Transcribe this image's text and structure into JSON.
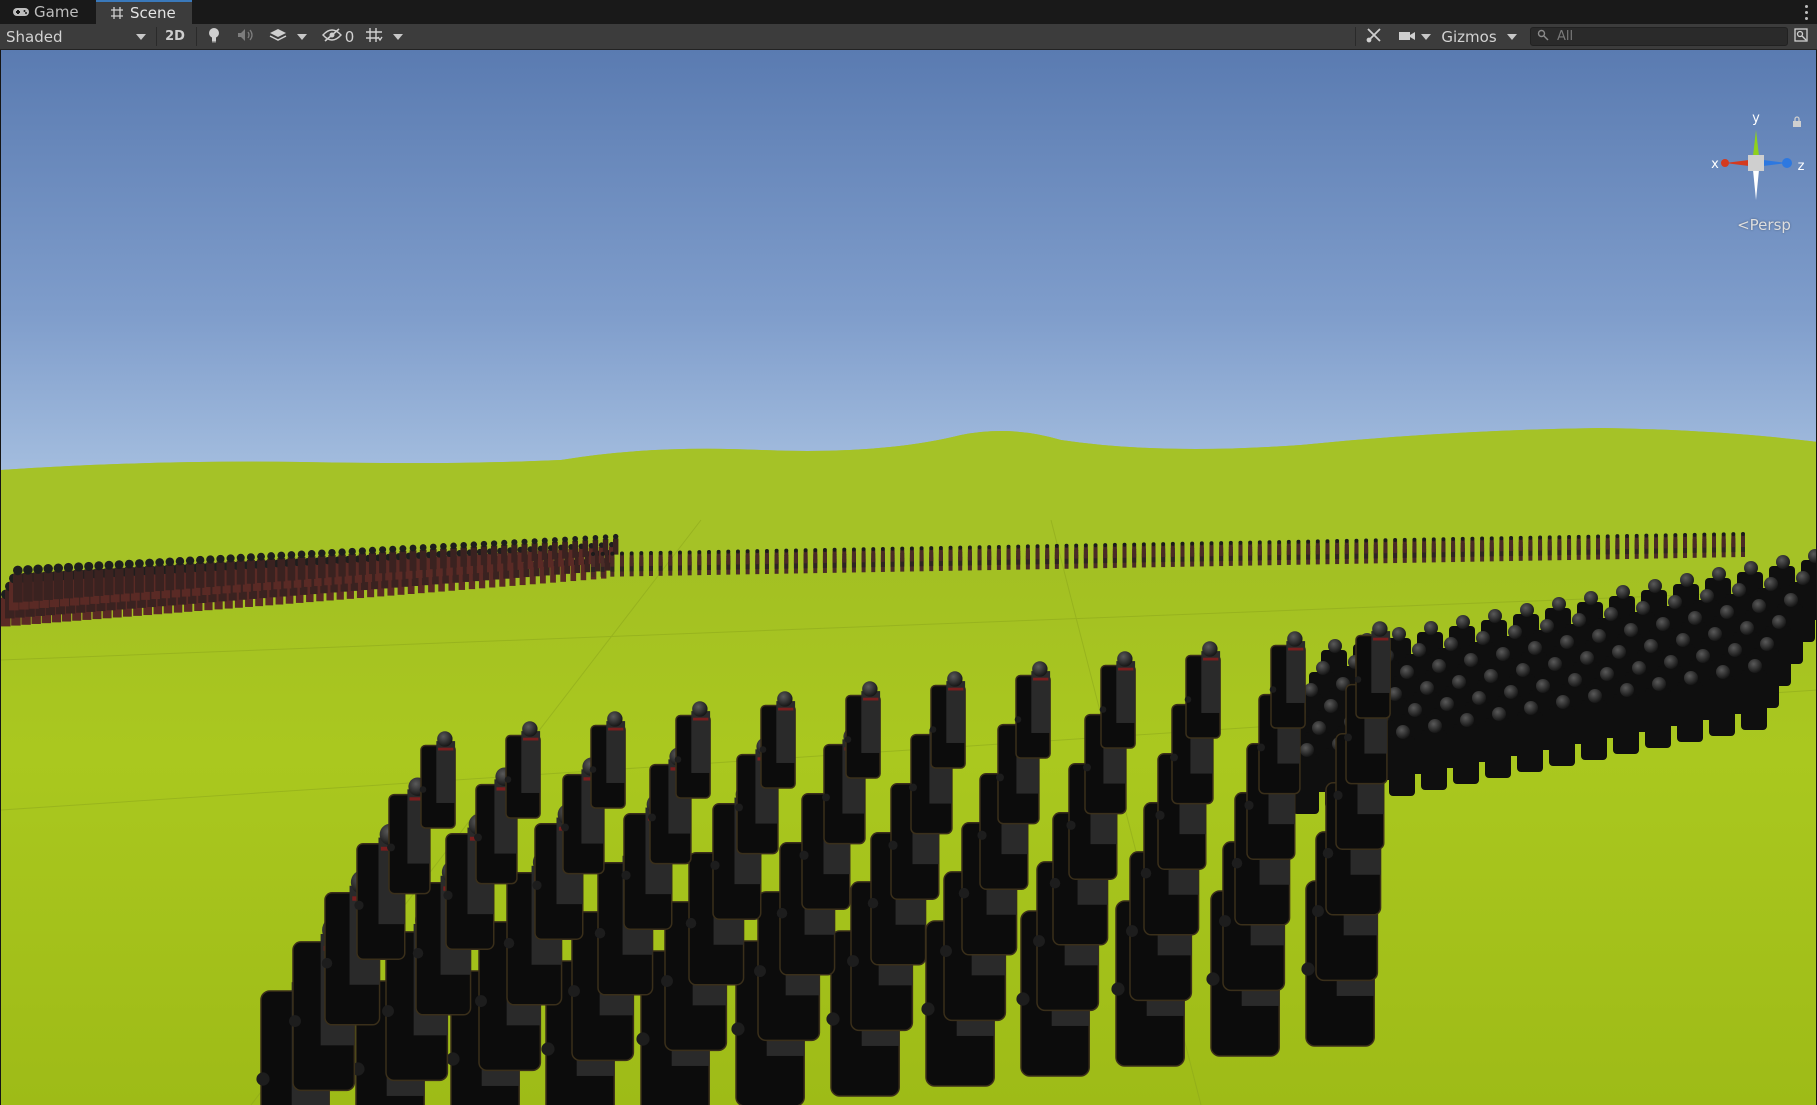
{
  "tabs": {
    "game_label": "Game",
    "scene_label": "Scene"
  },
  "toolbar": {
    "draw_mode": "Shaded",
    "two_d_label": "2D",
    "hidden_count": "0",
    "gizmos_label": "Gizmos",
    "search_placeholder": "All"
  },
  "gizmo": {
    "y_label": "y",
    "x_label": "x",
    "z_label": "z",
    "projection_label": "Persp"
  },
  "colors": {
    "sky_top": "#5a7bb1",
    "sky_horizon": "#a9c3e4",
    "grass": "#a9c81e",
    "axis_x": "#d43a1f",
    "axis_y": "#8ed11b",
    "axis_z": "#2d78e0"
  },
  "icons": {
    "game_tab": "gamepad-icon",
    "scene_tab": "grid-icon",
    "lighting": "lightbulb-icon",
    "audio": "speaker-icon",
    "effects": "layers-icon",
    "visibility": "eye-slash-icon",
    "grid_snap": "grid-snap-icon",
    "tools": "tools-icon",
    "camera": "camera-icon",
    "search": "search-icon",
    "maximize": "maximize-icon",
    "lock": "lock-icon"
  }
}
